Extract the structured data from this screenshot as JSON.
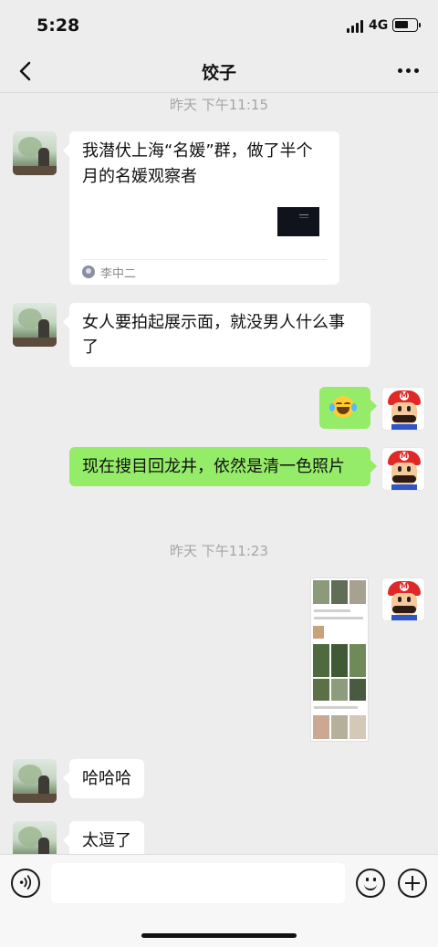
{
  "status_bar": {
    "time": "5:28",
    "network": "4G"
  },
  "nav": {
    "title": "饺子"
  },
  "timestamps": [
    "昨天 下午11:15",
    "昨天 下午11:23"
  ],
  "messages": [
    {
      "side": "left",
      "type": "link",
      "title": "我潜伏上海“名媛”群，做了半个月的名媛观察者",
      "source": "李中二"
    },
    {
      "side": "left",
      "type": "text",
      "text": "女人要拍起展示面，就没男人什么事了"
    },
    {
      "side": "right",
      "type": "emoji",
      "emoji": "tears-of-joy"
    },
    {
      "side": "right",
      "type": "text",
      "text": "现在搜目回龙井，依然是清一色照片"
    },
    {
      "side": "right",
      "type": "image",
      "description": "screenshot"
    },
    {
      "side": "left",
      "type": "text",
      "text": "哈哈哈"
    },
    {
      "side": "left",
      "type": "text",
      "text": "太逗了"
    }
  ],
  "input": {
    "placeholder": ""
  },
  "colors": {
    "background": "#ededed",
    "sent_bubble": "#95ec69",
    "received_bubble": "#ffffff",
    "timestamp": "#a5a5a5"
  }
}
